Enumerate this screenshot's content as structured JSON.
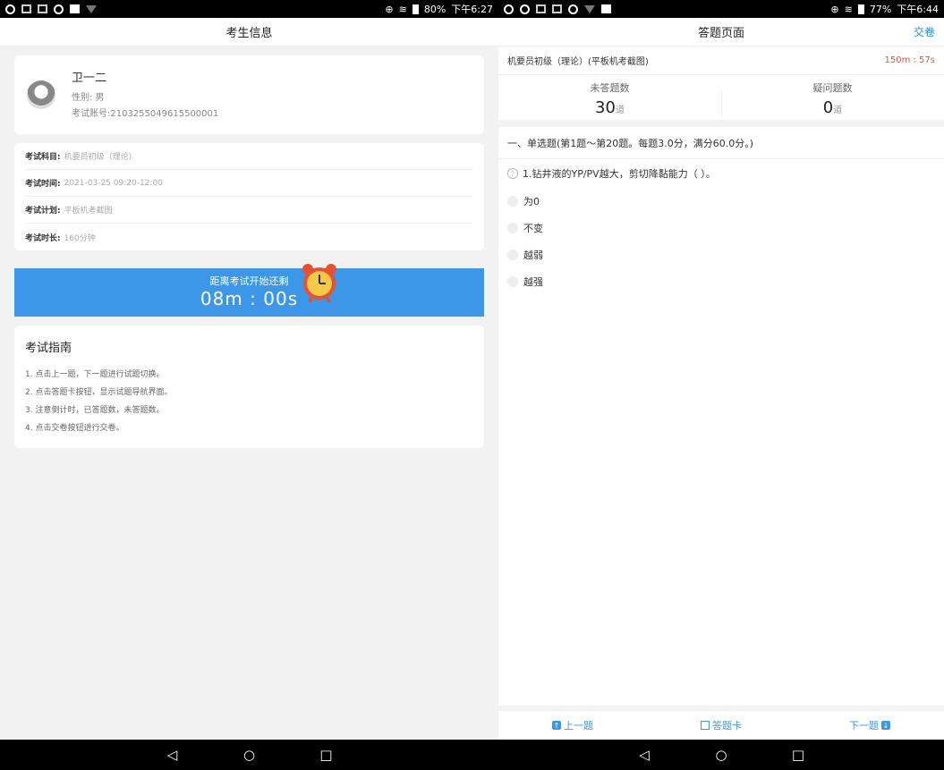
{
  "left_screen": {
    "statusbar": {
      "icons": [
        "search-icon",
        "grid-icon",
        "grid-icon",
        "search-icon",
        "image-icon",
        "wifi-icon"
      ],
      "battery": "80%",
      "time": "下午6:27"
    },
    "title": "考生信息",
    "profile": {
      "name": "卫一二",
      "gender": "性别: 男",
      "exam_number": "考试账号:2103255049615500001"
    },
    "info": [
      {
        "key": "考试科目:",
        "value": "机要员初级（理论）"
      },
      {
        "key": "考试时间:",
        "value": "2021-03-25 09:20-12:00"
      },
      {
        "key": "考试计划:",
        "value": "平板机考截图"
      },
      {
        "key": "考试时长:",
        "value": "160分钟"
      }
    ],
    "countdown": {
      "label": "距离考试开始还剩",
      "time": "08m : 00s"
    },
    "guide": {
      "title": "考试指南",
      "items": [
        "1. 点击上一题，下一题进行试题切换。",
        "2. 点击答题卡按钮，显示试题导航界面。",
        "3. 注意倒计时，已答题数，未答题数。",
        "4. 点击交卷按钮进行交卷。"
      ]
    }
  },
  "right_screen": {
    "statusbar": {
      "icons": [
        "search-icon",
        "search-icon",
        "grid-icon",
        "grid-icon",
        "search-icon",
        "wifi-icon",
        "image-icon"
      ],
      "battery": "77%",
      "time": "下午6:44"
    },
    "title": "答题页面",
    "submit_label": "交卷",
    "exam_name": "机要员初级（理论）(平板机考截图)",
    "timer": "150m : 57s",
    "stats": {
      "unanswered_label": "未答题数",
      "unanswered_value": "30",
      "unanswered_unit": "道",
      "doubt_label": "疑问题数",
      "doubt_value": "0",
      "doubt_unit": "道"
    },
    "section": "一、单选题(第1题～第20题。每题3.0分，满分60.0分。)",
    "question": "1.钻井液的YP/PV越大，剪切降黏能力（ ）。",
    "options": [
      "为0",
      "不变",
      "越弱",
      "越强"
    ],
    "bottom": {
      "prev": "上一题",
      "card": "答题卡",
      "next": "下一题"
    }
  },
  "colors": {
    "accent": "#3d97e8",
    "timer": "#e5543b",
    "link": "#2f8ae5"
  }
}
